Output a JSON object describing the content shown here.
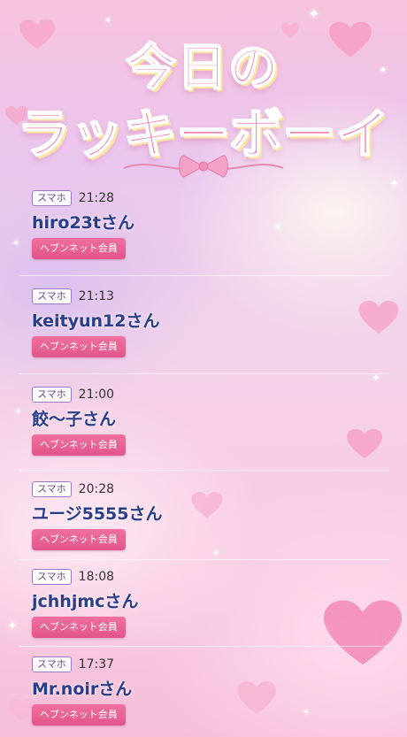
{
  "header": {
    "title_line1": "今日の",
    "title_line2": "ラッキーボーイ"
  },
  "entries": [
    {
      "device": "スマホ",
      "time": "21:28",
      "name": "hiro23tさん",
      "member_label": "ヘブンネット会員"
    },
    {
      "device": "スマホ",
      "time": "21:13",
      "name": "keityun12さん",
      "member_label": "ヘブンネット会員"
    },
    {
      "device": "スマホ",
      "time": "21:00",
      "name": "餃〜子さん",
      "member_label": "ヘブンネット会員"
    },
    {
      "device": "スマホ",
      "time": "20:28",
      "name": "ユージ5555さん",
      "member_label": "ヘブンネット会員"
    },
    {
      "device": "スマホ",
      "time": "18:08",
      "name": "jchhjmcさん",
      "member_label": "ヘブンネット会員"
    },
    {
      "device": "スマホ",
      "time": "17:37",
      "name": "Mr.noirさん",
      "member_label": "ヘブンネット会員"
    }
  ],
  "theme": {
    "title_color": "#f06fa6",
    "name_color": "#2a3f88",
    "button_color": "#e95f92",
    "badge_border": "#9b7cc4"
  },
  "icons": [
    "heart-icon",
    "sparkle-icon",
    "ribbon-bow-icon"
  ]
}
